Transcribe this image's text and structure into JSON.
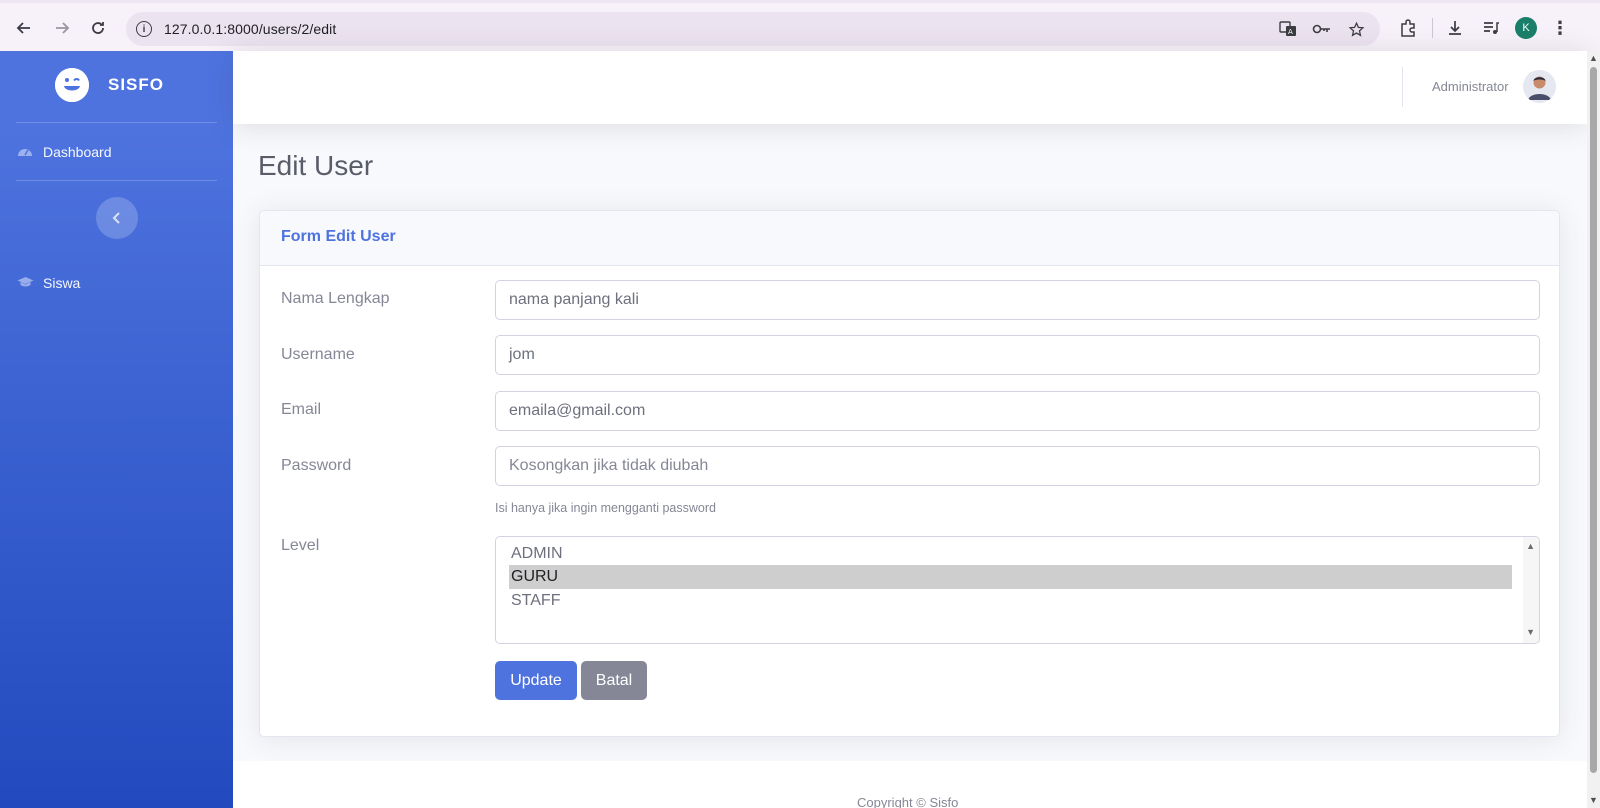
{
  "browser": {
    "url": "127.0.0.1:8000/users/2/edit",
    "profile_initial": "K"
  },
  "sidebar": {
    "brand": "SISFO",
    "items": [
      {
        "label": "Dashboard",
        "icon": "tachometer-icon"
      },
      {
        "label": "Siswa",
        "icon": "graduation-cap-icon"
      }
    ]
  },
  "topbar": {
    "user_name": "Administrator"
  },
  "page": {
    "title": "Edit User"
  },
  "form": {
    "card_title": "Form Edit User",
    "fields": {
      "nama_label": "Nama Lengkap",
      "nama_value": "nama panjang kali",
      "username_label": "Username",
      "username_value": "jom",
      "email_label": "Email",
      "email_value": "emaila@gmail.com",
      "password_label": "Password",
      "password_placeholder": "Kosongkan jika tidak diubah",
      "password_help": "Isi hanya jika ingin mengganti password",
      "level_label": "Level",
      "level_options": [
        "ADMIN",
        "GURU",
        "STAFF"
      ],
      "level_selected": "GURU"
    },
    "buttons": {
      "update": "Update",
      "batal": "Batal"
    }
  },
  "footer": {
    "copyright": "Copyright © Sisfo"
  },
  "colors": {
    "primary": "#4e73df",
    "secondary": "#858796",
    "sidebar_gradient_end": "#224abe"
  }
}
